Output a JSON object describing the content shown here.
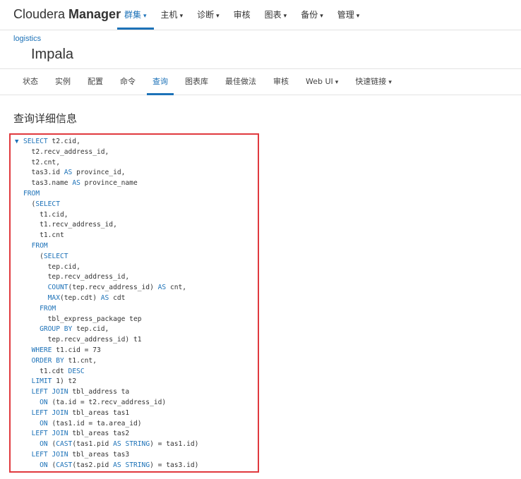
{
  "brand": {
    "prefix": "Cloudera ",
    "name": "Manager"
  },
  "top_nav": [
    {
      "label": "群集",
      "dropdown": true,
      "active": true
    },
    {
      "label": "主机",
      "dropdown": true,
      "active": false
    },
    {
      "label": "诊断",
      "dropdown": true,
      "active": false
    },
    {
      "label": "审核",
      "dropdown": false,
      "active": false
    },
    {
      "label": "图表",
      "dropdown": true,
      "active": false
    },
    {
      "label": "备份",
      "dropdown": true,
      "active": false
    },
    {
      "label": "管理",
      "dropdown": true,
      "active": false
    }
  ],
  "breadcrumb": "logistics",
  "service_name": "Impala",
  "tabs": [
    {
      "label": "状态",
      "dropdown": false,
      "active": false
    },
    {
      "label": "实例",
      "dropdown": false,
      "active": false
    },
    {
      "label": "配置",
      "dropdown": false,
      "active": false
    },
    {
      "label": "命令",
      "dropdown": false,
      "active": false
    },
    {
      "label": "查询",
      "dropdown": false,
      "active": true
    },
    {
      "label": "图表库",
      "dropdown": false,
      "active": false
    },
    {
      "label": "最佳做法",
      "dropdown": false,
      "active": false
    },
    {
      "label": "审核",
      "dropdown": false,
      "active": false
    },
    {
      "label": "Web UI",
      "dropdown": true,
      "active": false
    },
    {
      "label": "快速链接",
      "dropdown": true,
      "active": false
    }
  ],
  "section_title": "查询详细信息",
  "query_lines": [
    "SELECT t2.cid,",
    "  t2.recv_address_id,",
    "  t2.cnt,",
    "  tas3.id AS province_id,",
    "  tas3.name AS province_name",
    "FROM",
    "  (SELECT",
    "    t1.cid,",
    "    t1.recv_address_id,",
    "    t1.cnt",
    "  FROM",
    "    (SELECT",
    "      tep.cid,",
    "      tep.recv_address_id,",
    "      COUNT(tep.recv_address_id) AS cnt,",
    "      MAX(tep.cdt) AS cdt",
    "    FROM",
    "      tbl_express_package tep",
    "    GROUP BY tep.cid,",
    "      tep.recv_address_id) t1",
    "  WHERE t1.cid = 73",
    "  ORDER BY t1.cnt,",
    "    t1.cdt DESC",
    "  LIMIT 1) t2",
    "  LEFT JOIN tbl_address ta",
    "    ON (ta.id = t2.recv_address_id)",
    "  LEFT JOIN tbl_areas tas1",
    "    ON (tas1.id = ta.area_id)",
    "  LEFT JOIN tbl_areas tas2",
    "    ON (CAST(tas1.pid AS STRING) = tas1.id)",
    "  LEFT JOIN tbl_areas tas3",
    "    ON (CAST(tas2.pid AS STRING) = tas3.id)"
  ],
  "colors": {
    "accent": "#1d72b8",
    "highlight_border": "#e0393e"
  },
  "icons": {
    "collapse": "chevron-down-icon",
    "dropdown": "caret-down-icon"
  }
}
